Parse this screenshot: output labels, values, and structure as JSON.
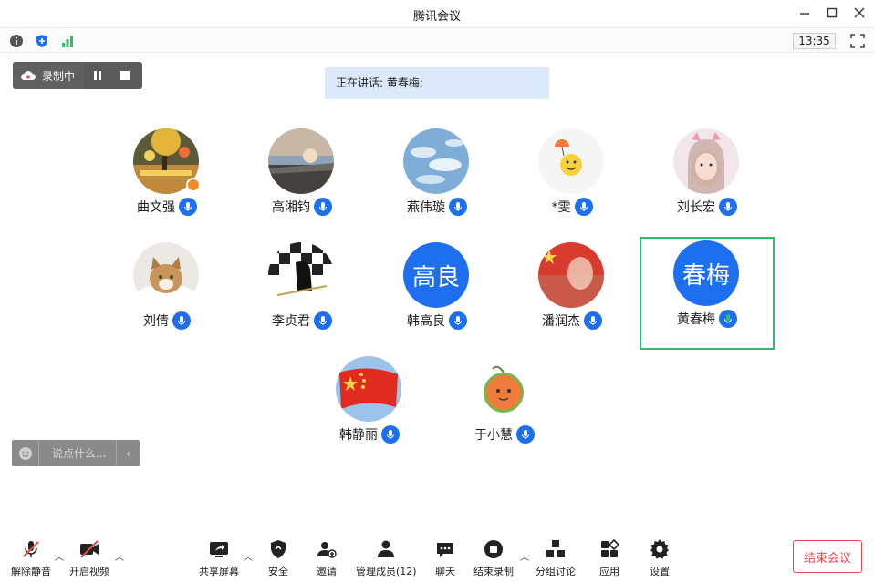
{
  "window": {
    "title": "腾讯会议"
  },
  "status": {
    "clock": "13:35"
  },
  "recording": {
    "label": "录制中"
  },
  "speaking": {
    "text": "正在讲话: 黄春梅;"
  },
  "participants": [
    {
      "name": "曲文强",
      "avatar_type": "photo",
      "host": true
    },
    {
      "name": "高湘钧",
      "avatar_type": "photo"
    },
    {
      "name": "燕伟璇",
      "avatar_type": "photo"
    },
    {
      "name": "*雯",
      "avatar_type": "photo"
    },
    {
      "name": "刘长宏",
      "avatar_type": "photo"
    },
    {
      "name": "刘倩",
      "avatar_type": "photo"
    },
    {
      "name": "李贞君",
      "avatar_type": "photo"
    },
    {
      "name": "韩高良",
      "avatar_type": "text",
      "avatar_text": "高良"
    },
    {
      "name": "潘润杰",
      "avatar_type": "photo"
    },
    {
      "name": "黄春梅",
      "avatar_type": "text",
      "avatar_text": "春梅",
      "speaking": true
    },
    {
      "name": "韩静丽",
      "avatar_type": "photo"
    },
    {
      "name": "于小慧",
      "avatar_type": "photo"
    }
  ],
  "chat": {
    "placeholder": "说点什么..."
  },
  "toolbar": {
    "unmute": "解除静音",
    "start_video": "开启视频",
    "share_screen": "共享屏幕",
    "security": "安全",
    "invite": "邀请",
    "manage_members": "管理成员(12)",
    "chat": "聊天",
    "stop_recording": "结束录制",
    "breakout": "分组讨论",
    "apps": "应用",
    "settings": "设置",
    "end_meeting": "结束会议"
  },
  "colors": {
    "accent": "#1e6ff0",
    "active_border": "#2ebd6b",
    "danger": "#e34a4a"
  }
}
